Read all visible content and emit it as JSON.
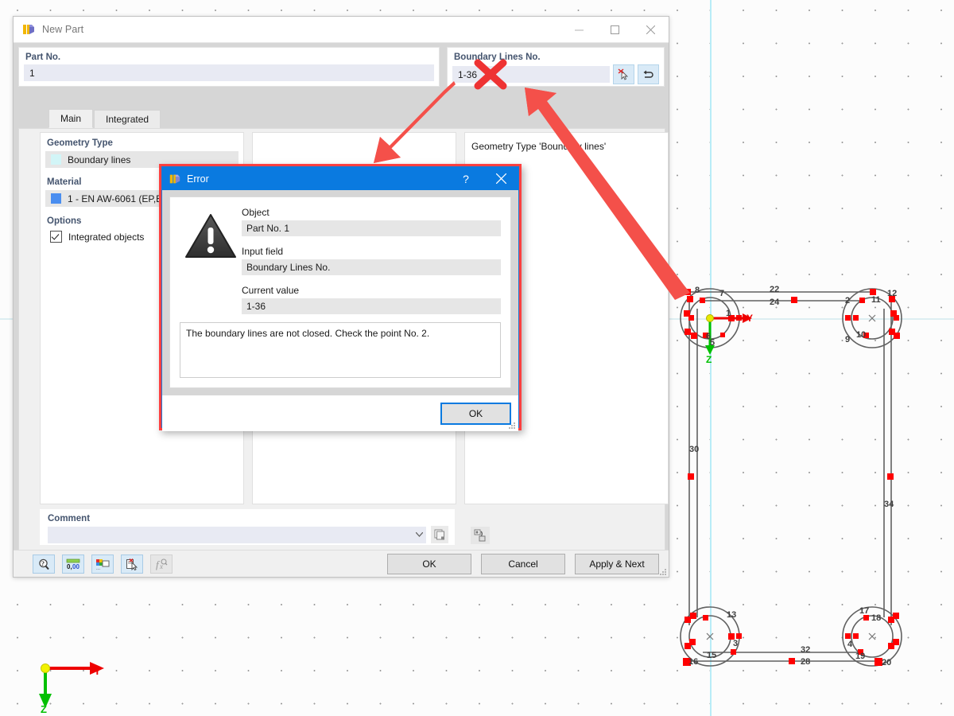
{
  "window": {
    "title": "New Part",
    "icon": "part-icon",
    "minimize": "minimize-icon",
    "maximize": "maximize-icon",
    "close": "close-icon"
  },
  "part_no": {
    "label": "Part No.",
    "value": "1"
  },
  "boundary_lines": {
    "label": "Boundary Lines No.",
    "value": "1-36",
    "pick_button": "pick-deselect-icon",
    "reverse_button": "reverse-icon"
  },
  "tabs": [
    {
      "label": "Main",
      "active": true
    },
    {
      "label": "Integrated",
      "active": false
    }
  ],
  "geometry_type": {
    "label": "Geometry Type",
    "value": "Boundary lines",
    "swatch_color": "#d2f5f7"
  },
  "material": {
    "label": "Material",
    "value": "1 - EN AW-6061 (EP,ET,ER/B",
    "swatch_color": "#4a8ef0"
  },
  "options": {
    "label": "Options",
    "items": [
      {
        "label": "Integrated objects",
        "checked": true
      }
    ]
  },
  "info_panel": {
    "text": "Geometry Type 'Boundary lines'"
  },
  "comment": {
    "label": "Comment",
    "value": "",
    "dropdown_icon": "chevron-down-icon",
    "copy_icon": "copy-icon",
    "import_icon": "import-icon"
  },
  "footer_tools": [
    {
      "name": "help-icon",
      "disabled": false
    },
    {
      "name": "units-icon",
      "disabled": false
    },
    {
      "name": "display-properties-icon",
      "disabled": false
    },
    {
      "name": "detail-settings-icon",
      "disabled": false
    },
    {
      "name": "formula-icon",
      "disabled": true
    }
  ],
  "footer_buttons": [
    {
      "label": "OK",
      "name": "ok-button"
    },
    {
      "label": "Cancel",
      "name": "cancel-button"
    },
    {
      "label": "Apply & Next",
      "name": "apply-next-button"
    }
  ],
  "error_dialog": {
    "title": "Error",
    "icon": "part-icon",
    "help_label": "?",
    "close_label": "✕",
    "object_label": "Object",
    "object_value": "Part No. 1",
    "input_field_label": "Input field",
    "input_field_value": "Boundary Lines No.",
    "current_value_label": "Current value",
    "current_value": "1-36",
    "message": "The boundary lines are not closed. Check the point No. 2.",
    "ok_label": "OK",
    "warning_icon": "warning-triangle-icon",
    "accent_color": "#0a7ae0",
    "highlight_color": "#ff4040"
  },
  "annotations": {
    "cross_color": "#ee3333",
    "arrow_color": "#f4504a",
    "cross_mark": "x-mark",
    "arrow_to_dialog": "arrow-pointing-to-error-dialog",
    "arrow_to_field": "arrow-pointing-to-boundary-lines-field"
  },
  "cad_view": {
    "axis_triad": {
      "y_label": "Y",
      "z_label": "Z",
      "y_color": "#ee0000",
      "z_color": "#00c000",
      "origin_color": "#e8e800"
    },
    "model_axis_labels": {
      "y": "Y",
      "z": "Z"
    },
    "line_numbers": [
      "1",
      "2",
      "3",
      "4",
      "5",
      "6",
      "7",
      "8",
      "9",
      "10",
      "11",
      "12",
      "13",
      "15",
      "16",
      "17",
      "18",
      "19",
      "20",
      "22",
      "24",
      "28",
      "30",
      "32",
      "34"
    ],
    "node_color": "#ff0000",
    "line_color": "#606060"
  }
}
